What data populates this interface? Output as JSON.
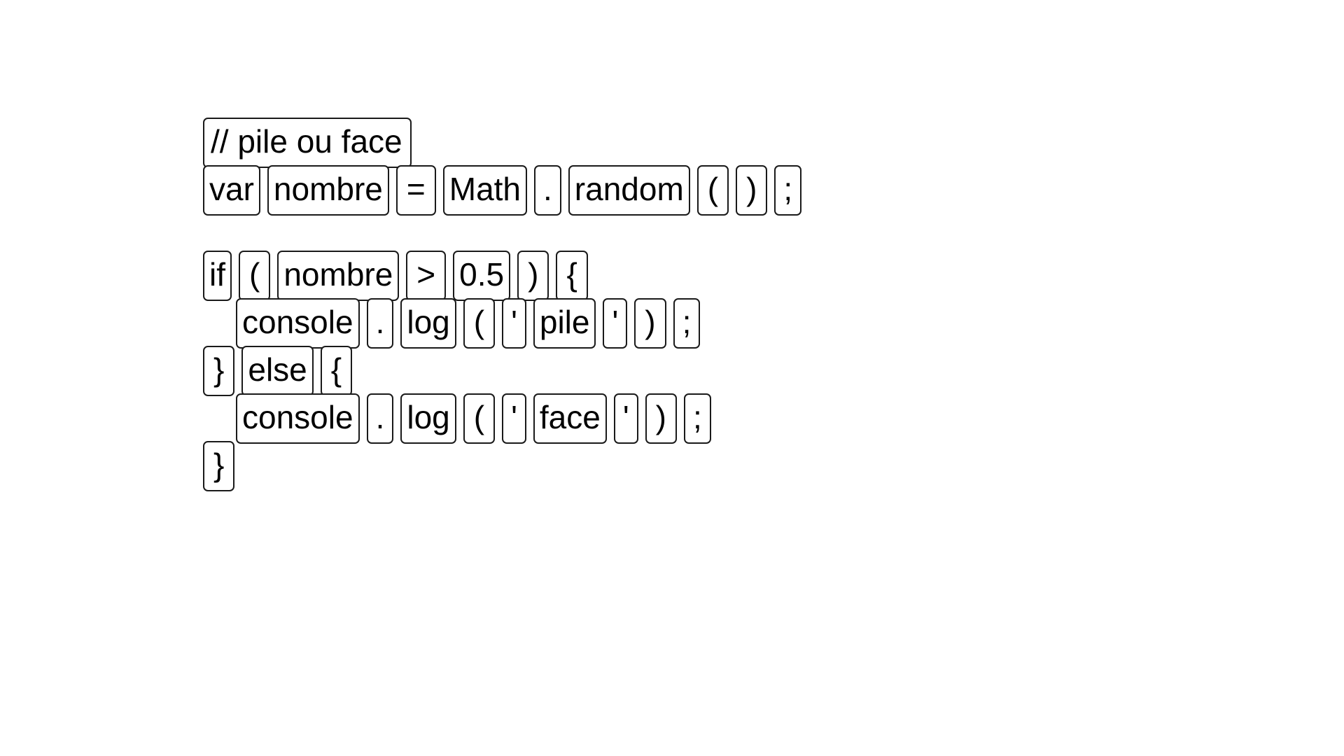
{
  "document": {
    "title": "pile ou face",
    "language": "javascript",
    "background_color": "#ffffff",
    "token_border_color": "#1a1a1a",
    "token_text_color": "#000000"
  },
  "code": {
    "lines": [
      {
        "id": "line-comment",
        "indent": 0,
        "tokens": [
          {
            "text": "// pile ou face",
            "kind": "comment"
          }
        ]
      },
      {
        "id": "line-var-declaration",
        "indent": 0,
        "tokens": [
          {
            "text": "var",
            "kind": "keyword"
          },
          {
            "text": "nombre",
            "kind": "identifier"
          },
          {
            "text": "=",
            "kind": "operator"
          },
          {
            "text": "Math",
            "kind": "identifier"
          },
          {
            "text": ".",
            "kind": "punctuation"
          },
          {
            "text": "random",
            "kind": "identifier"
          },
          {
            "text": "(",
            "kind": "punctuation"
          },
          {
            "text": ")",
            "kind": "punctuation"
          },
          {
            "text": ";",
            "kind": "punctuation"
          }
        ]
      },
      {
        "id": "line-blank",
        "indent": 0,
        "blank": true,
        "tokens": []
      },
      {
        "id": "line-if",
        "indent": 0,
        "tokens": [
          {
            "text": "if",
            "kind": "keyword"
          },
          {
            "text": "(",
            "kind": "punctuation"
          },
          {
            "text": "nombre",
            "kind": "identifier"
          },
          {
            "text": ">",
            "kind": "operator"
          },
          {
            "text": "0.5",
            "kind": "number"
          },
          {
            "text": ")",
            "kind": "punctuation"
          },
          {
            "text": "{",
            "kind": "punctuation"
          }
        ]
      },
      {
        "id": "line-log-pile",
        "indent": 1,
        "tokens": [
          {
            "text": "console",
            "kind": "identifier"
          },
          {
            "text": ".",
            "kind": "punctuation"
          },
          {
            "text": "log",
            "kind": "identifier"
          },
          {
            "text": "(",
            "kind": "punctuation"
          },
          {
            "text": "'",
            "kind": "punctuation"
          },
          {
            "text": "pile",
            "kind": "string"
          },
          {
            "text": "'",
            "kind": "punctuation"
          },
          {
            "text": ")",
            "kind": "punctuation"
          },
          {
            "text": ";",
            "kind": "punctuation"
          }
        ]
      },
      {
        "id": "line-else",
        "indent": 0,
        "tokens": [
          {
            "text": "}",
            "kind": "punctuation"
          },
          {
            "text": "else",
            "kind": "keyword"
          },
          {
            "text": "{",
            "kind": "punctuation"
          }
        ]
      },
      {
        "id": "line-log-face",
        "indent": 1,
        "tokens": [
          {
            "text": "console",
            "kind": "identifier"
          },
          {
            "text": ".",
            "kind": "punctuation"
          },
          {
            "text": "log",
            "kind": "identifier"
          },
          {
            "text": "(",
            "kind": "punctuation"
          },
          {
            "text": "'",
            "kind": "punctuation"
          },
          {
            "text": "face",
            "kind": "string"
          },
          {
            "text": "'",
            "kind": "punctuation"
          },
          {
            "text": ")",
            "kind": "punctuation"
          },
          {
            "text": ";",
            "kind": "punctuation"
          }
        ]
      },
      {
        "id": "line-close-brace",
        "indent": 0,
        "tokens": [
          {
            "text": "}",
            "kind": "punctuation"
          }
        ]
      }
    ]
  }
}
